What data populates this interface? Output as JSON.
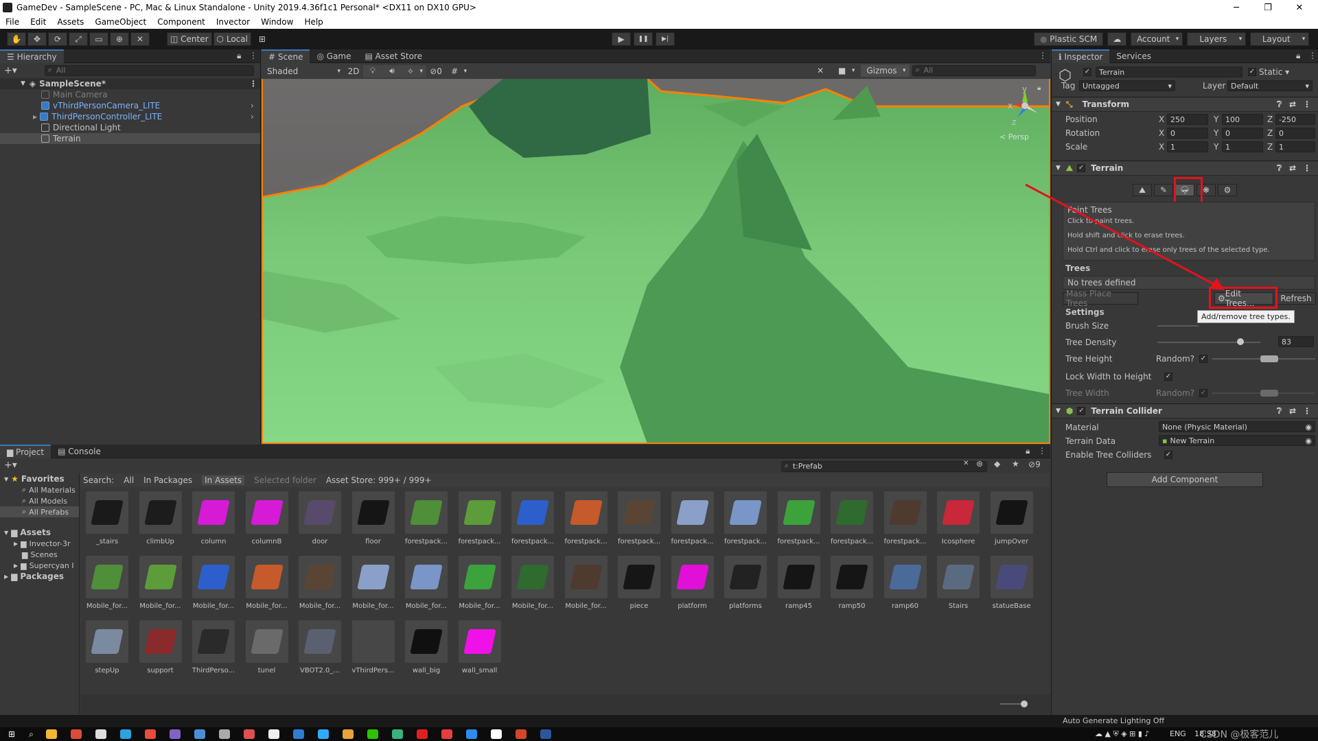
{
  "window": {
    "title": "GameDev - SampleScene - PC, Mac & Linux Standalone - Unity 2019.4.36f1c1 Personal* <DX11 on DX10 GPU>",
    "controls": [
      "─",
      "❐",
      "✕"
    ]
  },
  "menu": [
    "File",
    "Edit",
    "Assets",
    "GameObject",
    "Component",
    "Invector",
    "Window",
    "Help"
  ],
  "toolbar": {
    "tools": [
      "hand-icon",
      "move-icon",
      "rotate-icon",
      "scale-icon",
      "rect-icon",
      "transform-icon",
      "custom-tool-icon"
    ],
    "pivot": "Center",
    "space": "Local",
    "play": "▶",
    "pause": "❚❚",
    "step": "▶|",
    "plastic": "Plastic SCM",
    "account": "Account",
    "layers": "Layers",
    "layout": "Layout"
  },
  "hierarchy": {
    "tab": "Hierarchy",
    "search_placeholder": "All",
    "scene": "SampleScene*",
    "items": [
      {
        "label": "Main Camera",
        "style": "muted"
      },
      {
        "label": "vThirdPersonCamera_LITE",
        "style": "prefab"
      },
      {
        "label": "ThirdPersonController_LITE",
        "style": "prefab"
      },
      {
        "label": "Directional Light",
        "style": "normal"
      },
      {
        "label": "Terrain",
        "style": "selected"
      }
    ]
  },
  "scene": {
    "tabs": [
      "Scene",
      "Game",
      "Asset Store"
    ],
    "shading": "Shaded",
    "mode2d": "2D",
    "hidden_count": "0",
    "gizmos": "Gizmos",
    "search_placeholder": "All",
    "persp": "< Persp",
    "axes": {
      "y": "y",
      "x": "x",
      "z": "z"
    }
  },
  "inspector": {
    "tabs": [
      "Inspector",
      "Services"
    ],
    "object_name": "Terrain",
    "static": "Static",
    "tag_label": "Tag",
    "tag": "Untagged",
    "layer_label": "Layer",
    "layer": "Default",
    "transform": {
      "title": "Transform",
      "rows": [
        {
          "label": "Position",
          "x": "250",
          "y": "100",
          "z": "-250"
        },
        {
          "label": "Rotation",
          "x": "0",
          "y": "0",
          "z": "0"
        },
        {
          "label": "Scale",
          "x": "1",
          "y": "1",
          "z": "1"
        }
      ]
    },
    "terrain": {
      "title": "Terrain",
      "tool_icons": [
        "raise-terrain-icon",
        "paint-brush-icon",
        "paint-trees-icon",
        "paint-details-icon",
        "terrain-settings-icon"
      ],
      "paint_title": "Paint Trees",
      "help": [
        "Click to paint trees.",
        "Hold shift and click to erase trees.",
        "Hold Ctrl and click to erase only trees of the selected type."
      ],
      "trees_label": "Trees",
      "no_trees": "No trees defined",
      "mass_place": "Mass Place Trees",
      "edit_trees": "Edit Trees...",
      "refresh": "Refresh",
      "tooltip": "Add/remove tree types.",
      "settings_label": "Settings",
      "brush_size": "Brush Size",
      "tree_density": "Tree Density",
      "tree_density_value": "83",
      "tree_density_fraction": 0.83,
      "tree_height": "Tree Height",
      "random": "Random?",
      "lock_width": "Lock Width to Height",
      "tree_width": "Tree Width"
    },
    "collider": {
      "title": "Terrain Collider",
      "material_label": "Material",
      "material": "None (Physic Material)",
      "data_label": "Terrain Data",
      "data": "New Terrain",
      "enable_label": "Enable Tree Colliders"
    },
    "add_component": "Add Component"
  },
  "project": {
    "tabs": [
      "Project",
      "Console"
    ],
    "search_value": "t:Prefab",
    "hidden_count": "9",
    "search_label": "Search:",
    "filters": [
      "All",
      "In Packages",
      "In Assets",
      "Selected folder",
      "Asset Store: 999+ / 999+"
    ],
    "favorites": {
      "label": "Favorites",
      "items": [
        "All Materials",
        "All Models",
        "All Prefabs"
      ]
    },
    "assets_tree": {
      "label": "Assets",
      "items": [
        "Invector-3r",
        "Scenes",
        "Supercyan I"
      ]
    },
    "packages": "Packages",
    "assets": [
      {
        "name": "_stairs",
        "color": "#1a1a1a"
      },
      {
        "name": "climbUp",
        "color": "#1c1c1c"
      },
      {
        "name": "column",
        "color": "#d61ad6"
      },
      {
        "name": "columnB",
        "color": "#d61ad6"
      },
      {
        "name": "door",
        "color": "#584a6a"
      },
      {
        "name": "floor",
        "color": "#151515"
      },
      {
        "name": "forestpack...",
        "color": "#4f8f3a"
      },
      {
        "name": "forestpack...",
        "color": "#5c9c3a"
      },
      {
        "name": "forestpack...",
        "color": "#2d5fcc"
      },
      {
        "name": "forestpack...",
        "color": "#c65a2a"
      },
      {
        "name": "forestpack...",
        "color": "#5a4535"
      },
      {
        "name": "forestpack...",
        "color": "#8aa0c8"
      },
      {
        "name": "forestpack...",
        "color": "#7a96c8"
      },
      {
        "name": "forestpack...",
        "color": "#3ca23c"
      },
      {
        "name": "forestpack...",
        "color": "#2f6a2f"
      },
      {
        "name": "forestpack...",
        "color": "#4f3a30"
      },
      {
        "name": "Icosphere",
        "color": "#c8283a"
      },
      {
        "name": "jumpOver",
        "color": "#141414"
      },
      {
        "name": "Mobile_for...",
        "color": "#4f8f3a"
      },
      {
        "name": "Mobile_for...",
        "color": "#5c9c3a"
      },
      {
        "name": "Mobile_for...",
        "color": "#2d5fcc"
      },
      {
        "name": "Mobile_for...",
        "color": "#c65a2a"
      },
      {
        "name": "Mobile_for...",
        "color": "#5a4535"
      },
      {
        "name": "Mobile_for...",
        "color": "#8aa0c8"
      },
      {
        "name": "Mobile_for...",
        "color": "#7a96c8"
      },
      {
        "name": "Mobile_for...",
        "color": "#3ca23c"
      },
      {
        "name": "Mobile_for...",
        "color": "#2f6a2f"
      },
      {
        "name": "Mobile_for...",
        "color": "#4f3a30"
      },
      {
        "name": "piece",
        "color": "#161616"
      },
      {
        "name": "platform",
        "color": "#e010d8"
      },
      {
        "name": "platforms",
        "color": "#222222"
      },
      {
        "name": "ramp45",
        "color": "#151515"
      },
      {
        "name": "ramp50",
        "color": "#151515"
      },
      {
        "name": "ramp60",
        "color": "#4a6a9a"
      },
      {
        "name": "Stairs",
        "color": "#5a6a80"
      },
      {
        "name": "statueBase",
        "color": "#4a4a7a"
      },
      {
        "name": "stepUp",
        "color": "#7a8aa0"
      },
      {
        "name": "support",
        "color": "#8a2a2a"
      },
      {
        "name": "ThirdPerso...",
        "color": "#2a2a2a"
      },
      {
        "name": "tunel",
        "color": "#6a6a6a"
      },
      {
        "name": "VBOT2.0_...",
        "color": "#5a6070"
      },
      {
        "name": "vThirdPers...",
        "color": "#474747"
      },
      {
        "name": "wall_big",
        "color": "#101010"
      },
      {
        "name": "wall_small",
        "color": "#f010e8"
      }
    ]
  },
  "status": {
    "lighting": "Auto Generate Lighting Off"
  },
  "taskbar": {
    "right_text": "CSDN @极客范儿",
    "ime": "ENG",
    "time": "18:38"
  },
  "colors": {
    "accent": "#3a79bb",
    "highlight": "#e4121d",
    "terrain": "#7fcf7f",
    "outline": "#ff8000"
  }
}
